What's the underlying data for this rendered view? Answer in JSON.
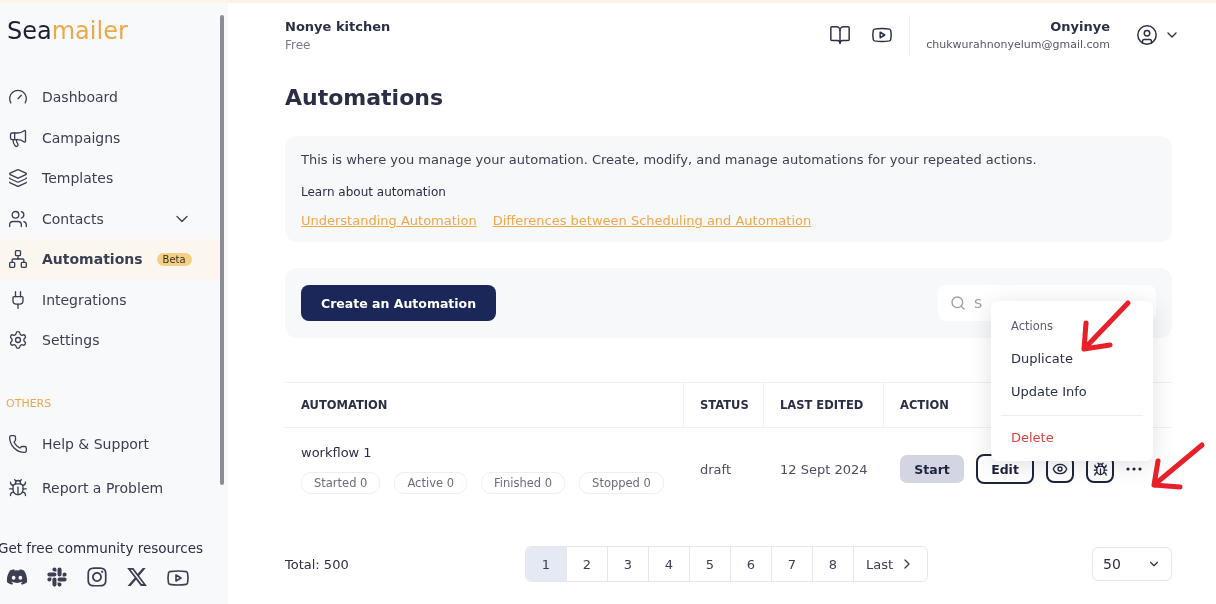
{
  "brand": {
    "part_1": "Sea",
    "part_2": "mailer"
  },
  "sidebar": {
    "items": [
      {
        "label": "Dashboard",
        "kind": "dashboard",
        "selected": false
      },
      {
        "label": "Campaigns",
        "kind": "campaigns",
        "selected": false
      },
      {
        "label": "Templates",
        "kind": "templates",
        "selected": false
      },
      {
        "label": "Contacts",
        "kind": "contacts",
        "selected": false,
        "expandable": true
      },
      {
        "label": "Automations",
        "kind": "automations",
        "selected": true,
        "badge": "Beta"
      },
      {
        "label": "Integrations",
        "kind": "integrations",
        "selected": false
      },
      {
        "label": "Settings",
        "kind": "settings",
        "selected": false
      }
    ],
    "section_title": "OTHERS",
    "other_items": [
      {
        "label": "Help & Support",
        "kind": "help"
      },
      {
        "label": "Report a Problem",
        "kind": "report"
      }
    ],
    "community_title": "Get free community resources",
    "community_links": [
      {
        "kind": "discord"
      },
      {
        "kind": "slack"
      },
      {
        "kind": "instagram"
      },
      {
        "kind": "x"
      },
      {
        "kind": "youtube"
      }
    ]
  },
  "header": {
    "workspace": "Nonye kitchen",
    "plan": "Free",
    "user_name": "Onyinye",
    "user_email": "chukwurahnonyelum@gmail.com"
  },
  "page_title": "Automations",
  "info": {
    "text": "This is where you manage your automation. Create, modify, and manage automations for your repeated actions.",
    "learn_title": "Learn about automation",
    "links": [
      "Understanding Automation",
      "Differences between Scheduling and Automation"
    ]
  },
  "toolbar": {
    "create_button": "Create an Automation",
    "search": {
      "placeholder": "S"
    }
  },
  "menu": {
    "title": "Actions",
    "items": [
      {
        "label": "Duplicate",
        "kind": "normal"
      },
      {
        "label": "Update Info",
        "kind": "normal"
      },
      {
        "label": "Delete",
        "kind": "danger"
      }
    ]
  },
  "table": {
    "columns": [
      "AUTOMATION",
      "STATUS",
      "LAST EDITED",
      "ACTION"
    ],
    "rows": [
      {
        "name": "workflow 1",
        "counts": [
          "Started 0",
          "Active 0",
          "Finished 0",
          "Stopped 0"
        ],
        "status": "draft",
        "last_edited": "12 Sept 2024",
        "start": "Start",
        "edit": "Edit"
      }
    ]
  },
  "footer": {
    "total": "Total: 500",
    "pages": [
      {
        "label": "1",
        "selected": true
      },
      {
        "label": "2",
        "selected": false
      },
      {
        "label": "3",
        "selected": false
      },
      {
        "label": "4",
        "selected": false
      },
      {
        "label": "5",
        "selected": false
      },
      {
        "label": "6",
        "selected": false
      },
      {
        "label": "7",
        "selected": false
      },
      {
        "label": "8",
        "selected": false
      }
    ],
    "last": "Last",
    "page_size": "50"
  }
}
